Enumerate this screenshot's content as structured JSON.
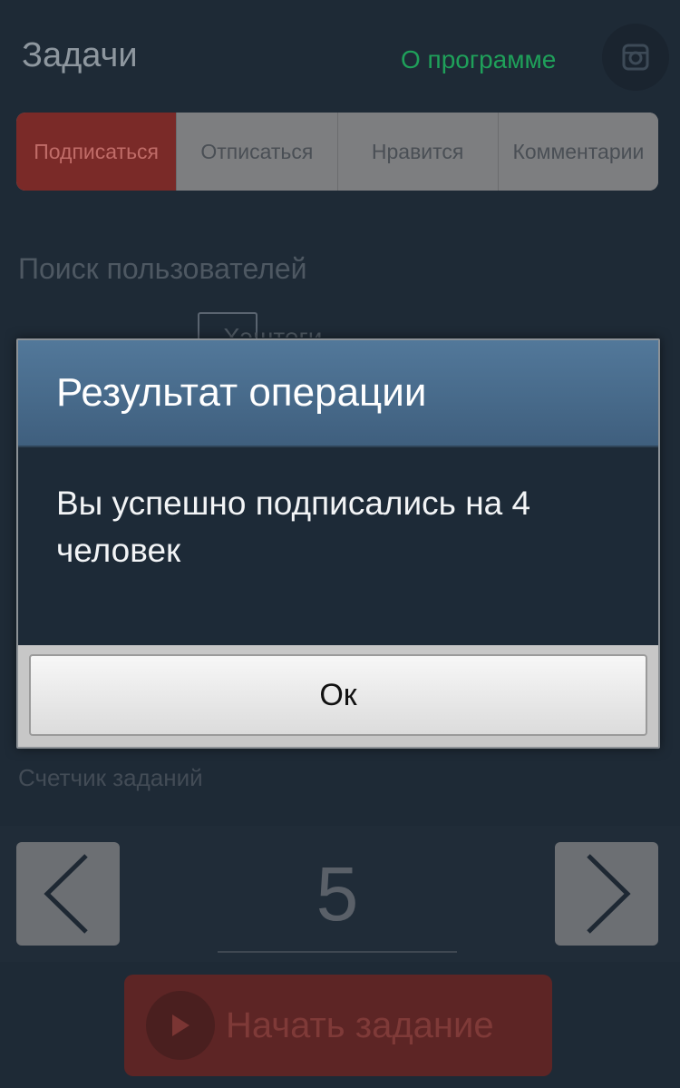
{
  "header": {
    "title": "Задачи",
    "about_link": "О программе",
    "instagram_icon": "instagram-icon"
  },
  "tabs": [
    {
      "label": "Подписаться",
      "active": true
    },
    {
      "label": "Отписаться",
      "active": false
    },
    {
      "label": "Нравится",
      "active": false
    },
    {
      "label": "Комментарии",
      "active": false
    }
  ],
  "search": {
    "label": "Поиск пользователей",
    "hashtag_label": "Хэштеги"
  },
  "counter": {
    "label": "Счетчик заданий",
    "value": "5",
    "prev_icon": "chevron-left-icon",
    "next_icon": "chevron-right-icon"
  },
  "start": {
    "label": "Начать задание",
    "icon": "play-icon"
  },
  "dialog": {
    "title": "Результат операции",
    "message": "Вы успешно подписались на 4 человек",
    "ok_label": "Ок"
  },
  "colors": {
    "accent_green": "#1fa05a",
    "active_tab": "#7a2a28",
    "dialog_header": "#4a6e90"
  }
}
